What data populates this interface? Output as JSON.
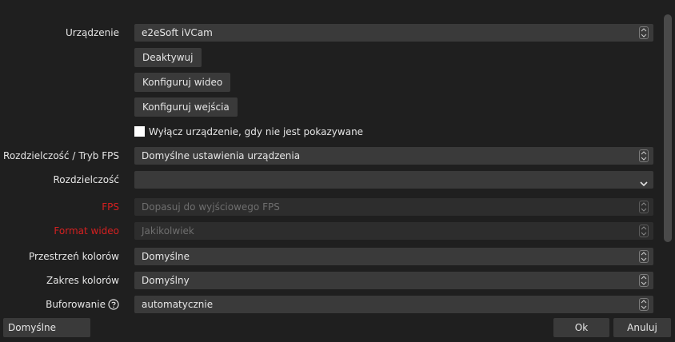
{
  "rows": {
    "device": {
      "label": "Urządzenie",
      "value": "e2eSoft iVCam"
    },
    "resolution_fps_mode": {
      "label": "Rozdzielczość / Tryb FPS",
      "value": "Domyślne ustawienia urządzenia"
    },
    "resolution": {
      "label": "Rozdzielczość",
      "value": ""
    },
    "fps": {
      "label": "FPS",
      "value": "Dopasuj do wyjściowego FPS"
    },
    "video_format": {
      "label": "Format wideo",
      "value": "Jakikolwiek"
    },
    "color_space": {
      "label": "Przestrzeń kolorów",
      "value": "Domyślne"
    },
    "color_range": {
      "label": "Zakres kolorów",
      "value": "Domyślny"
    },
    "buffering": {
      "label": "Buforowanie",
      "value": "automatycznie"
    }
  },
  "buttons": {
    "deactivate": "Deaktywuj",
    "configure_video": "Konfiguruj wideo",
    "configure_inputs": "Konfiguruj wejścia",
    "defaults": "Domyślne",
    "ok": "Ok",
    "cancel": "Anuluj"
  },
  "checkbox": {
    "label": "Wyłącz urządzenie, gdy nie jest pokazywane",
    "checked": false
  },
  "colors": {
    "background": "#1f1f1f",
    "field": "#3a3a3a",
    "disabled_field": "#2d2d2d",
    "warning_label": "#d42020"
  },
  "icons": {
    "spinner": "up-down-arrows-icon",
    "dropdown": "chevron-down-icon",
    "help": "question-circle-icon"
  }
}
